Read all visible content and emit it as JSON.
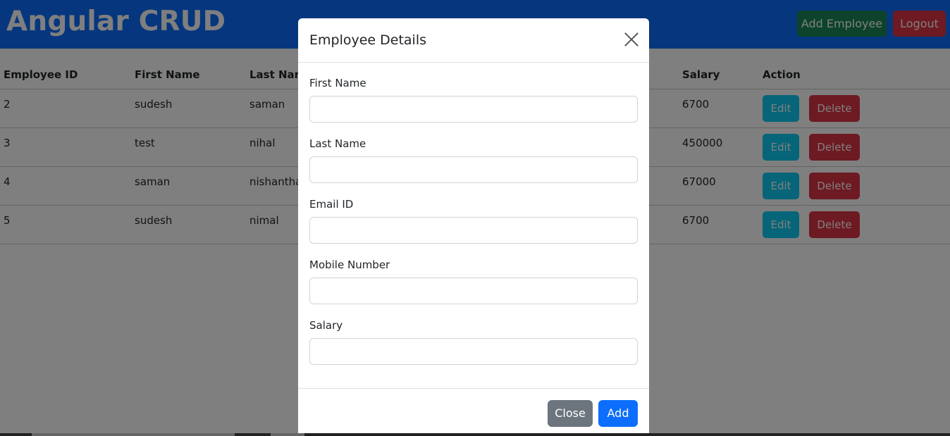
{
  "navbar": {
    "brand": "Angular CRUD",
    "add_employee_label": "Add Employee",
    "logout_label": "Logout"
  },
  "table": {
    "headers": [
      "Employee ID",
      "First Name",
      "Last Name",
      "Salary",
      "Action"
    ],
    "rows": [
      {
        "id": "2",
        "first": "sudesh",
        "last": "saman",
        "salary": "6700"
      },
      {
        "id": "3",
        "first": "test",
        "last": "nihal",
        "salary": "450000"
      },
      {
        "id": "4",
        "first": "saman",
        "last": "nishantha",
        "salary": "67000"
      },
      {
        "id": "5",
        "first": "sudesh",
        "last": "nimal",
        "salary": "6700"
      }
    ],
    "edit_label": "Edit",
    "delete_label": "Delete"
  },
  "modal": {
    "title": "Employee Details",
    "fields": [
      {
        "label": "First Name",
        "value": ""
      },
      {
        "label": "Last Name",
        "value": ""
      },
      {
        "label": "Email ID",
        "value": ""
      },
      {
        "label": "Mobile Number",
        "value": ""
      },
      {
        "label": "Salary",
        "value": ""
      }
    ],
    "close_label": "Close",
    "add_label": "Add"
  },
  "colors": {
    "primary": "#0d6efd",
    "success": "#198754",
    "danger": "#dc3545",
    "info": "#0dcaf0",
    "secondary": "#6c757d"
  }
}
